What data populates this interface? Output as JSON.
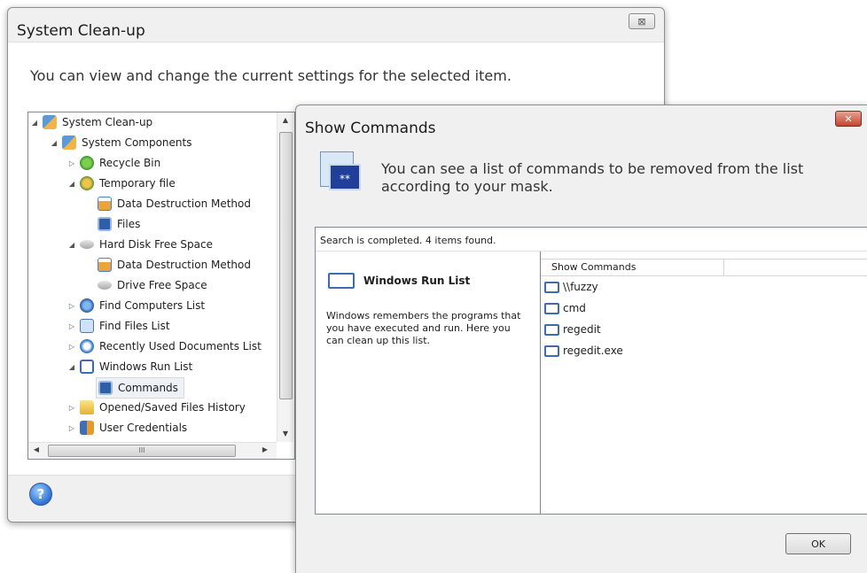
{
  "main_window": {
    "title": "System Clean-up",
    "description": "You can view and change the current settings for the selected item.",
    "close_glyph": "⊠",
    "tree": [
      {
        "label": "System Clean-up",
        "icon": "cleanup-icon",
        "expander": "◢"
      },
      {
        "label": "System Components",
        "icon": "cleanup-icon",
        "expander": "◢"
      },
      {
        "label": "Recycle Bin",
        "icon": "recycle-bin-icon",
        "expander": "▷"
      },
      {
        "label": "Temporary file",
        "icon": "temporary-file-icon",
        "expander": "◢"
      },
      {
        "label": "Data Destruction Method",
        "icon": "shredder-icon",
        "expander": ""
      },
      {
        "label": "Files",
        "icon": "files-icon",
        "expander": ""
      },
      {
        "label": "Hard Disk Free Space",
        "icon": "hard-disk-icon",
        "expander": "◢"
      },
      {
        "label": "Data Destruction Method",
        "icon": "shredder-icon",
        "expander": ""
      },
      {
        "label": "Drive Free Space",
        "icon": "drive-icon",
        "expander": ""
      },
      {
        "label": "Find Computers List",
        "icon": "find-computers-icon",
        "expander": "▷"
      },
      {
        "label": "Find Files List",
        "icon": "find-files-icon",
        "expander": "▷"
      },
      {
        "label": "Recently Used Documents List",
        "icon": "recent-documents-icon",
        "expander": "▷"
      },
      {
        "label": "Windows Run List",
        "icon": "run-list-icon",
        "expander": "◢"
      },
      {
        "label": "Commands",
        "icon": "commands-icon",
        "expander": ""
      },
      {
        "label": "Opened/Saved Files History",
        "icon": "folder-icon",
        "expander": "▷"
      },
      {
        "label": "User Credentials",
        "icon": "user-credentials-icon",
        "expander": "▷"
      }
    ],
    "scroll_thumb_grip": "III",
    "help_glyph": "?"
  },
  "commands_window": {
    "title": "Show Commands",
    "close_glyph": "✕",
    "description": "You can see a list of commands to be removed from the list according to your mask.",
    "status": "Search is completed. 4 items found.",
    "list_title": "Windows Run List",
    "list_help": "Windows remembers the programs that you have executed and run. Here you can clean up this list.",
    "column_header": "Show Commands",
    "commands": [
      "\\\\fuzzy",
      "cmd",
      "regedit",
      "regedit.exe"
    ],
    "ok_label": "OK"
  }
}
